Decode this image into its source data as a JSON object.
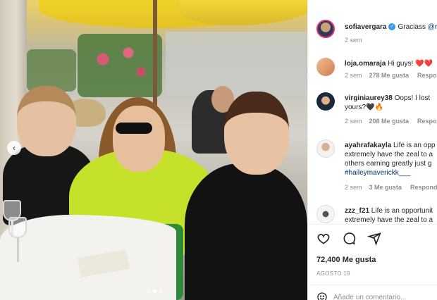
{
  "post": {
    "author": "sofiavergara",
    "caption": "Graciass",
    "caption_time": "2 sem",
    "likes": "72,400 Me gusta",
    "date": "AGOSTO 19",
    "add_comment": "Añade un comentario..."
  },
  "comments": [
    {
      "user": "loja.omaraja",
      "text": "Hi guys! ❤️❤️",
      "time": "2 sem",
      "likes": "278 Me gusta",
      "reply": "Responder"
    },
    {
      "user": "virginiaurey38",
      "text": "Oops! I lost",
      "text2": "yours?🖤🔥",
      "time": "2 sem",
      "likes": "208 Me gusta",
      "reply": "Responder"
    },
    {
      "user": "ayahrafakayla",
      "text": "Life is an opp",
      "text2": "extremely have the zeal to a",
      "text3": "others earning greatly just g",
      "tag": "#haileymaverickk___",
      "time": "2 sem",
      "likes": "3 Me gusta",
      "reply": "Responder"
    },
    {
      "user": "zzz_f21",
      "text": "Life is an opportunit",
      "text2": "extremely have the zeal to a"
    }
  ],
  "carousel": {
    "prev_icon": "‹",
    "dots": 3,
    "active_dot": 1
  },
  "colors": {
    "accent_link": "#00376b",
    "verified": "#3897f0",
    "heart": "#ed4956",
    "meta": "#8e8e8e"
  }
}
